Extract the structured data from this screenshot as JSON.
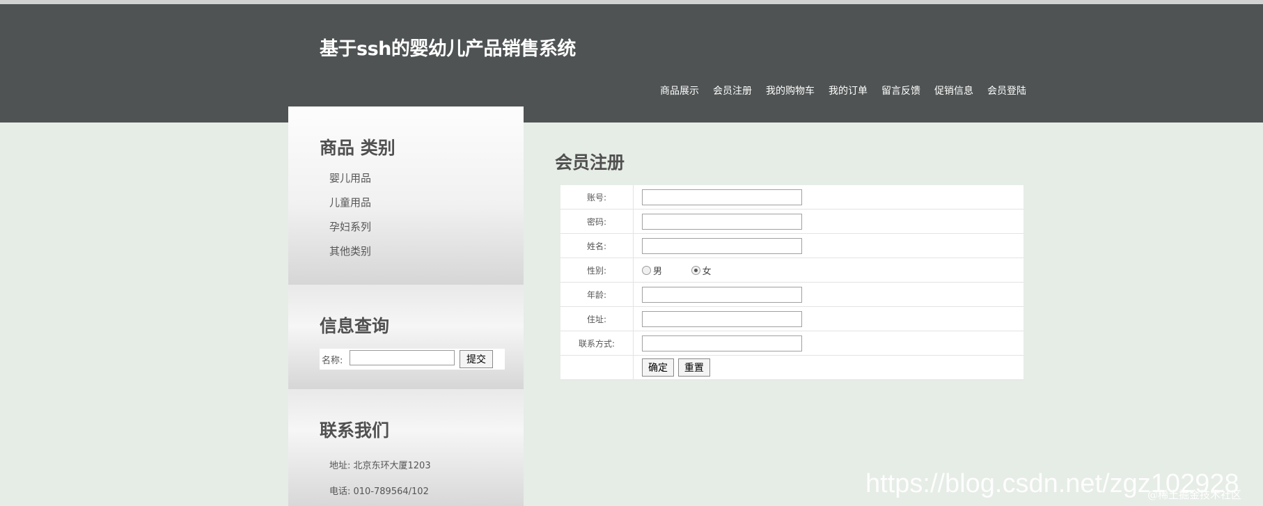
{
  "site": {
    "title": "基于ssh的婴幼儿产品销售系统"
  },
  "nav": [
    "商品展示",
    "会员注册",
    "我的购物车",
    "我的订单",
    "留言反馈",
    "促销信息",
    "会员登陆"
  ],
  "sidebar": {
    "categories": {
      "title": "商品 类别",
      "items": [
        "婴儿用品",
        "儿童用品",
        "孕妇系列",
        "其他类别"
      ]
    },
    "search": {
      "title": "信息查询",
      "label": "名称:",
      "value": "",
      "button": "提交"
    },
    "contact": {
      "title": "联系我们",
      "address": "地址: 北京东环大厦1203",
      "phone": "电话: 010-789564/102"
    }
  },
  "main": {
    "title": "会员注册",
    "form": {
      "account_label": "账号:",
      "password_label": "密码:",
      "name_label": "姓名:",
      "gender_label": "性别:",
      "gender_male": "男",
      "gender_female": "女",
      "age_label": "年龄:",
      "address_label": "住址:",
      "contact_label": "联系方式:",
      "submit": "确定",
      "reset": "重置"
    }
  },
  "watermark": {
    "url": "https://blog.csdn.net/zgz102928",
    "credit": "@稀土掘金技术社区"
  },
  "colors": {
    "header_bg": "#4f5353",
    "page_bg": "#e6ece6"
  }
}
